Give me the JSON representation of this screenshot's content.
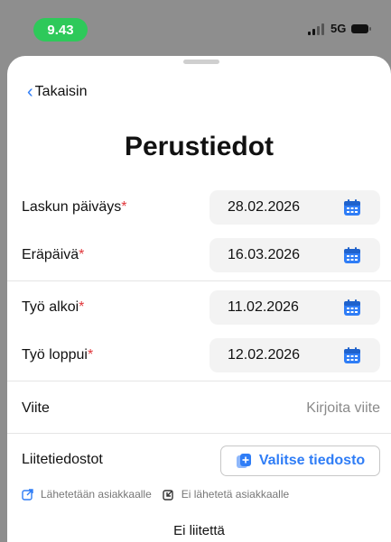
{
  "status_bar": {
    "time": "9.43",
    "network": "5G"
  },
  "nav": {
    "back_label": "Takaisin"
  },
  "page": {
    "title": "Perustiedot"
  },
  "dates": [
    {
      "label": "Laskun päiväys",
      "value": "28.02.2026"
    },
    {
      "label": "Eräpäivä",
      "value": "16.03.2026"
    },
    {
      "label": "Työ alkoi",
      "value": "11.02.2026"
    },
    {
      "label": "Työ loppui",
      "value": "12.02.2026"
    }
  ],
  "required_mark": "*",
  "reference": {
    "label": "Viite",
    "placeholder": "Kirjoita viite"
  },
  "attachments": {
    "label": "Liitetiedostot",
    "button_label": "Valitse tiedosto",
    "legend_sent": "Lähetetään asiakkaalle",
    "legend_not_sent": "Ei lähetetä asiakkaalle",
    "empty_text": "Ei liitettä"
  },
  "colors": {
    "accent": "#2f7df6",
    "required": "#e0373b",
    "time_pill": "#2ec95a"
  },
  "icons": {
    "date_field": "calendar-icon",
    "file_button": "file-add-icon",
    "legend_sent": "external-link-icon",
    "legend_not_sent": "link-in-icon"
  }
}
